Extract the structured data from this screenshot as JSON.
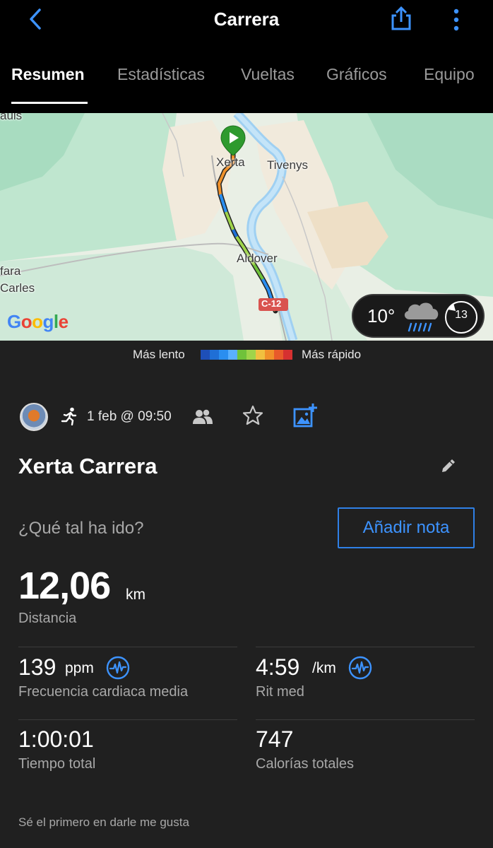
{
  "header": {
    "title": "Carrera",
    "back_icon": "chevron-left-icon",
    "share_icon": "share-icon",
    "more_icon": "more-vertical-icon"
  },
  "tabs": [
    {
      "label": "Resumen",
      "active": true
    },
    {
      "label": "Estadísticas",
      "active": false
    },
    {
      "label": "Vueltas",
      "active": false
    },
    {
      "label": "Gráficos",
      "active": false
    },
    {
      "label": "Equipo",
      "active": false
    }
  ],
  "map": {
    "places": {
      "xerta": "Xerta",
      "tivenys": "Tivenys",
      "aldover": "Aldover",
      "fara": "fara",
      "carles": "Carles",
      "auls": "auls"
    },
    "road_label": "C-12",
    "attribution": "Google",
    "weather": {
      "temperature": "10°",
      "icon": "rain-cloud-icon",
      "wind": "13"
    }
  },
  "legend": {
    "slow_label": "Más lento",
    "fast_label": "Más rápido",
    "colors": [
      "#1e4fb8",
      "#1f6fd6",
      "#2a8ef0",
      "#5ab0ff",
      "#6fc23a",
      "#9fd44a",
      "#f0c040",
      "#f0902a",
      "#e85a2a",
      "#d63030"
    ]
  },
  "activity": {
    "date": "1 feb @ 09:50",
    "title": "Xerta Carrera",
    "question": "¿Qué tal ha ido?",
    "add_note_label": "Añadir nota"
  },
  "stats": {
    "distance": {
      "value": "12,06",
      "unit": "km",
      "label": "Distancia"
    },
    "heart_rate": {
      "value": "139",
      "unit": "ppm",
      "label": "Frecuencia cardiaca media"
    },
    "pace": {
      "value": "4:59",
      "unit": "/km",
      "label": "Rit med"
    },
    "time": {
      "value": "1:00:01",
      "label": "Tiempo total"
    },
    "calories": {
      "value": "747",
      "label": "Calorías totales"
    }
  },
  "likes_text": "Sé el primero en darle me gusta",
  "colors": {
    "accent_blue": "#3d93ff",
    "panel_bg": "#202020"
  }
}
